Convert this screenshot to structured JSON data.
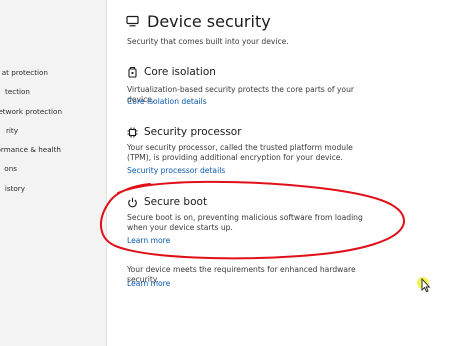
{
  "sidebar": {
    "items": [
      {
        "label": "at protection"
      },
      {
        "label": "tection"
      },
      {
        "label": "etwork protection"
      },
      {
        "label": "rity"
      },
      {
        "label": "ormance & health"
      },
      {
        "label": "ons"
      },
      {
        "label": "istory"
      }
    ]
  },
  "page": {
    "title": "Device security",
    "subtitle": "Security that comes built into your device.",
    "title_icon": "device-shield-icon"
  },
  "sections": {
    "core_isolation": {
      "title": "Core isolation",
      "icon": "core-isolation-icon",
      "description": "Virtualization-based security protects the core parts of your device.",
      "link": "Core isolation details"
    },
    "security_processor": {
      "title": "Security processor",
      "icon": "chip-icon",
      "description": "Your security processor, called the trusted platform module (TPM), is providing additional encryption for your device.",
      "link": "Security processor details"
    },
    "secure_boot": {
      "title": "Secure boot",
      "icon": "power-shield-icon",
      "description": "Secure boot is on, preventing malicious software from loading when your device starts up.",
      "link": "Learn more"
    },
    "hardware_status": {
      "description": "Your device meets the requirements for enhanced hardware security.",
      "link": "Learn more"
    }
  },
  "colors": {
    "link": "#0a5ab0",
    "annotation": "#e0101a",
    "cursor_highlight": "#f2f03a"
  }
}
